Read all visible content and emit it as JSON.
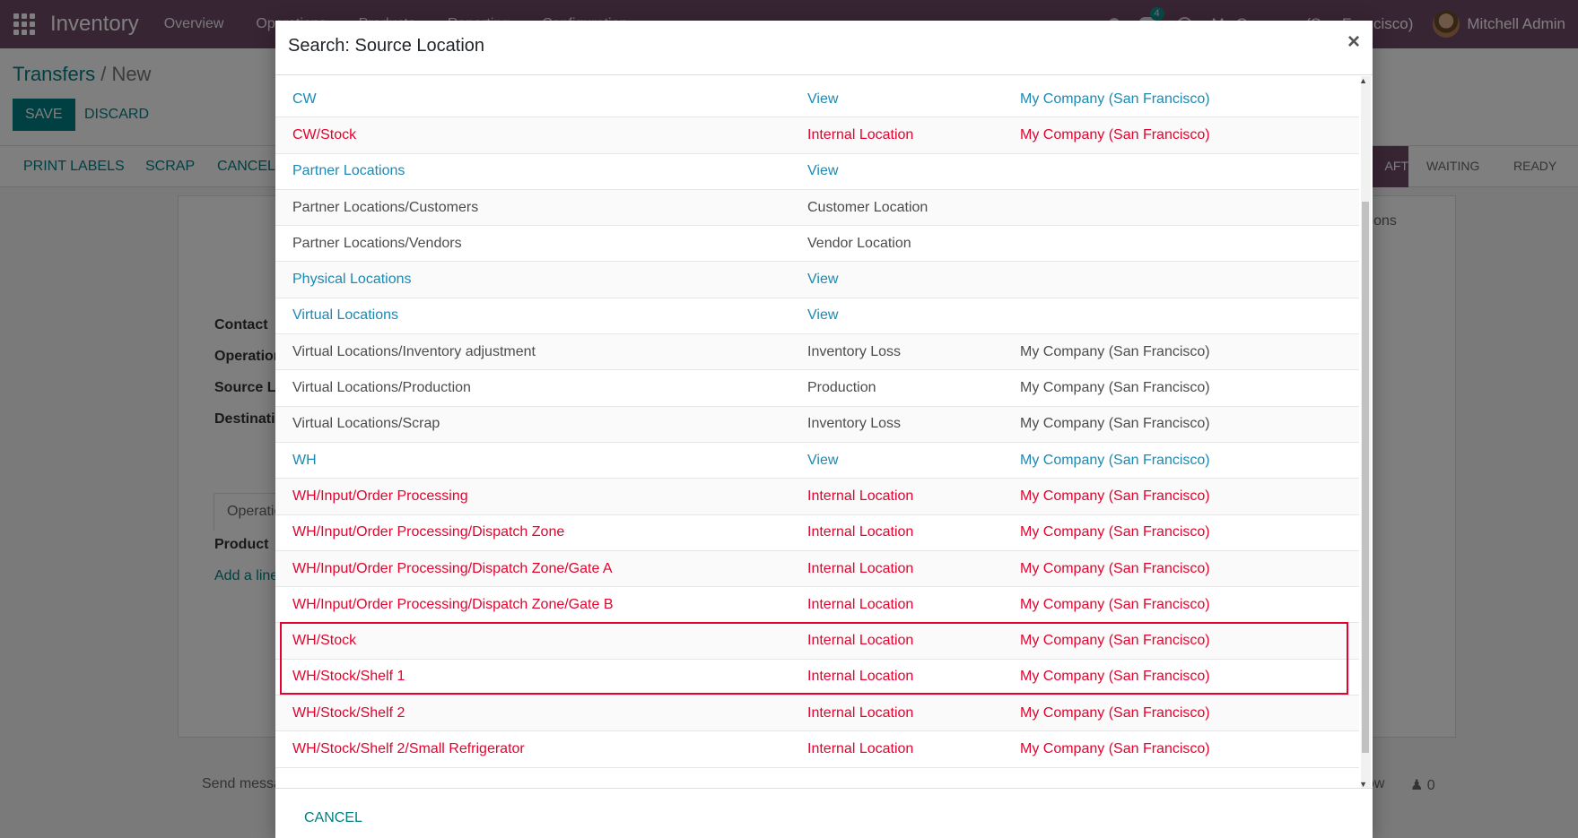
{
  "navbar": {
    "brand": "Inventory",
    "menu": [
      "Overview",
      "Operations",
      "Products",
      "Reporting",
      "Configuration"
    ],
    "messages_count": "4",
    "company": "My Company (San Francisco)",
    "user": "Mitchell Admin"
  },
  "form": {
    "breadcrumb_parent": "Transfers",
    "breadcrumb_sep": " / ",
    "breadcrumb_current": "New",
    "save_label": "SAVE",
    "discard_label": "DISCARD",
    "actions": [
      "PRINT LABELS",
      "SCRAP",
      "CANCEL"
    ],
    "stages": [
      "DRAFT",
      "WAITING",
      "READY"
    ],
    "stage_active_visible": "AFT",
    "labels": [
      "Contact",
      "Operation Type",
      "Source Location",
      "Destination Location"
    ],
    "tab_operations": "Operations",
    "tab_other_visible": "erations",
    "product_header": "Product",
    "add_line": "Add a line",
    "send_message": "Send message",
    "follow": "ow",
    "followers": "0"
  },
  "modal": {
    "title": "Search: Source Location",
    "close_label": "×",
    "cancel_label": "CANCEL",
    "rows": [
      {
        "name": "CW",
        "type": "View",
        "company": "My Company (San Francisco)",
        "style": "view"
      },
      {
        "name": "CW/Stock",
        "type": "Internal Location",
        "company": "My Company (San Francisco)",
        "style": "internal"
      },
      {
        "name": "Partner Locations",
        "type": "View",
        "company": "",
        "style": "view"
      },
      {
        "name": "Partner Locations/Customers",
        "type": "Customer Location",
        "company": "",
        "style": "normal"
      },
      {
        "name": "Partner Locations/Vendors",
        "type": "Vendor Location",
        "company": "",
        "style": "normal"
      },
      {
        "name": "Physical Locations",
        "type": "View",
        "company": "",
        "style": "view"
      },
      {
        "name": "Virtual Locations",
        "type": "View",
        "company": "",
        "style": "view"
      },
      {
        "name": "Virtual Locations/Inventory adjustment",
        "type": "Inventory Loss",
        "company": "My Company (San Francisco)",
        "style": "normal"
      },
      {
        "name": "Virtual Locations/Production",
        "type": "Production",
        "company": "My Company (San Francisco)",
        "style": "normal"
      },
      {
        "name": "Virtual Locations/Scrap",
        "type": "Inventory Loss",
        "company": "My Company (San Francisco)",
        "style": "normal"
      },
      {
        "name": "WH",
        "type": "View",
        "company": "My Company (San Francisco)",
        "style": "view"
      },
      {
        "name": "WH/Input/Order Processing",
        "type": "Internal Location",
        "company": "My Company (San Francisco)",
        "style": "internal"
      },
      {
        "name": "WH/Input/Order Processing/Dispatch Zone",
        "type": "Internal Location",
        "company": "My Company (San Francisco)",
        "style": "internal"
      },
      {
        "name": "WH/Input/Order Processing/Dispatch Zone/Gate A",
        "type": "Internal Location",
        "company": "My Company (San Francisco)",
        "style": "internal"
      },
      {
        "name": "WH/Input/Order Processing/Dispatch Zone/Gate B",
        "type": "Internal Location",
        "company": "My Company (San Francisco)",
        "style": "internal"
      },
      {
        "name": "WH/Stock",
        "type": "Internal Location",
        "company": "My Company (San Francisco)",
        "style": "internal"
      },
      {
        "name": "WH/Stock/Shelf 1",
        "type": "Internal Location",
        "company": "My Company (San Francisco)",
        "style": "internal"
      },
      {
        "name": "WH/Stock/Shelf 2",
        "type": "Internal Location",
        "company": "My Company (San Francisco)",
        "style": "internal"
      },
      {
        "name": "WH/Stock/Shelf 2/Small Refrigerator",
        "type": "Internal Location",
        "company": "My Company (San Francisco)",
        "style": "internal"
      }
    ]
  }
}
